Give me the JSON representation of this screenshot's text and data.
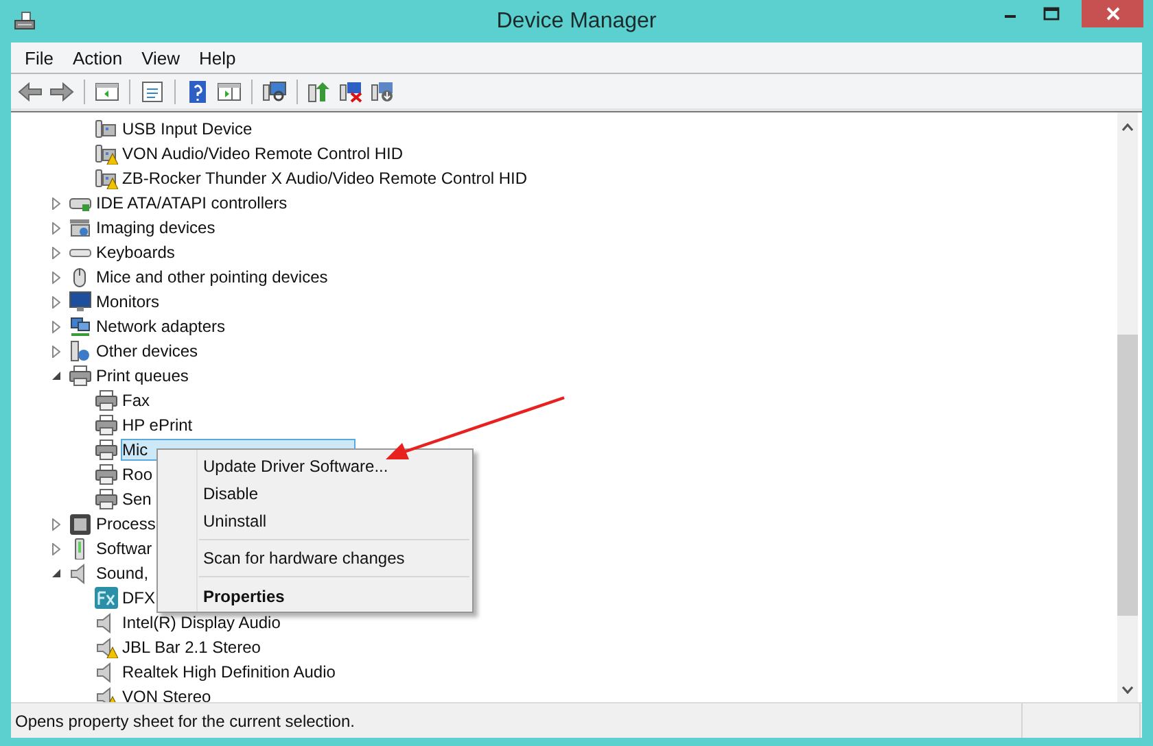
{
  "window": {
    "title": "Device Manager"
  },
  "menu_bar": [
    "File",
    "Action",
    "View",
    "Help"
  ],
  "tree": [
    {
      "children": [
        {
          "label": "USB Input Device",
          "warning": false
        },
        {
          "label": "VON Audio/Video Remote Control HID",
          "warning": true
        },
        {
          "label": "ZB-Rocker Thunder X Audio/Video Remote Control HID",
          "warning": true
        }
      ]
    },
    {
      "label": "IDE ATA/ATAPI controllers",
      "expanded": false
    },
    {
      "label": "Imaging devices",
      "expanded": false
    },
    {
      "label": "Keyboards",
      "expanded": false
    },
    {
      "label": "Mice and other pointing devices",
      "expanded": false
    },
    {
      "label": "Monitors",
      "expanded": false
    },
    {
      "label": "Network adapters",
      "expanded": false
    },
    {
      "label": "Other devices",
      "expanded": false
    },
    {
      "label": "Print queues",
      "expanded": true,
      "children": [
        {
          "label": "Fax",
          "selected": false
        },
        {
          "label": "HP ePrint",
          "selected": false
        },
        {
          "label": "Mic",
          "selected": true
        },
        {
          "label": "Roo",
          "selected": false
        },
        {
          "label": "Sen",
          "selected": false
        }
      ]
    },
    {
      "label": "Process",
      "expanded": false
    },
    {
      "label": "Softwar",
      "expanded": false
    },
    {
      "label": "Sound,",
      "expanded": true,
      "children": [
        {
          "label": "DFX",
          "warning": false
        },
        {
          "label": "Intel(R) Display Audio",
          "warning": false
        },
        {
          "label": "JBL Bar 2.1 Stereo",
          "warning": true
        },
        {
          "label": "Realtek High Definition Audio",
          "warning": false
        },
        {
          "label": "VON Stereo",
          "warning": true
        }
      ]
    }
  ],
  "context_menu": [
    {
      "kind": "item",
      "label": "Update Driver Software...",
      "default": false
    },
    {
      "kind": "item",
      "label": "Disable",
      "default": false
    },
    {
      "kind": "item",
      "label": "Uninstall",
      "default": false
    },
    {
      "kind": "separator"
    },
    {
      "kind": "item",
      "label": "Scan for hardware changes",
      "default": false
    },
    {
      "kind": "separator"
    },
    {
      "kind": "item",
      "label": "Properties",
      "default": true
    }
  ],
  "status_bar": "Opens property sheet for the current selection."
}
